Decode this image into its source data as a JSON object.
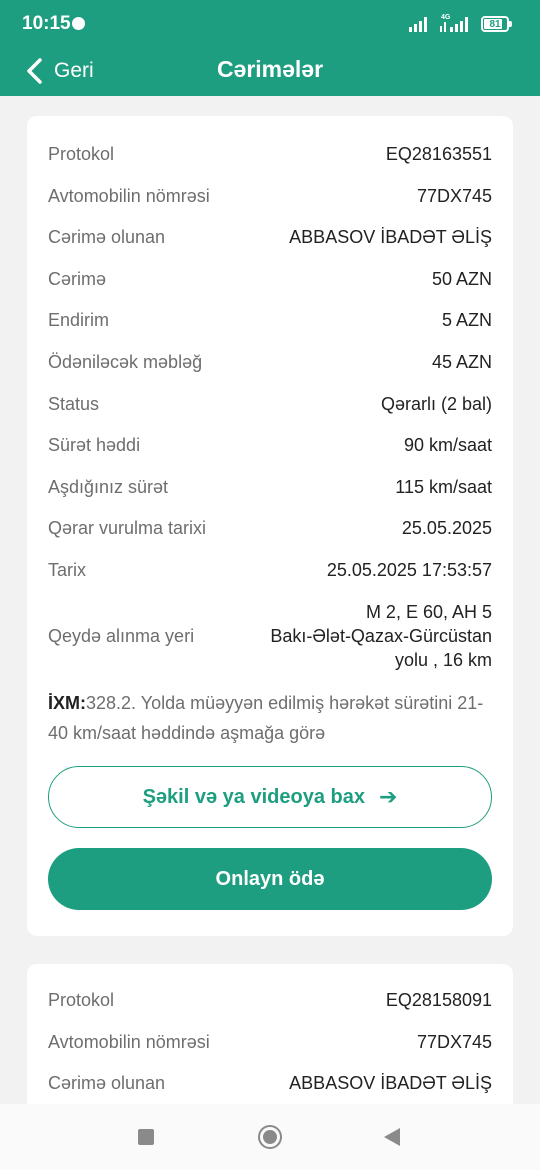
{
  "status_bar": {
    "time": "10:15",
    "network": "4G",
    "battery": "81"
  },
  "app_bar": {
    "back_label": "Geri",
    "title": "Cərimələr"
  },
  "fines": [
    {
      "rows": [
        {
          "label": "Protokol",
          "value": "EQ28163551"
        },
        {
          "label": "Avtomobilin nömrəsi",
          "value": "77DX745"
        },
        {
          "label": "Cərimə olunan",
          "value": "ABBASOV İBADƏT ƏLİŞ"
        },
        {
          "label": "Cərimə",
          "value": "50 AZN"
        },
        {
          "label": "Endirim",
          "value": "5 AZN"
        },
        {
          "label": "Ödəniləcək məbləğ",
          "value": "45 AZN"
        },
        {
          "label": "Status",
          "value": "Qərarlı (2 bal)"
        },
        {
          "label": "Sürət həddi",
          "value": "90 km/saat"
        },
        {
          "label": "Aşdığınız sürət",
          "value": "115 km/saat"
        },
        {
          "label": "Qərar vurulma tarixi",
          "value": "25.05.2025"
        },
        {
          "label": "Tarix",
          "value": "25.05.2025 17:53:57"
        }
      ],
      "location": {
        "label": "Qeydə alınma yeri",
        "lines": [
          "M 2, E 60, AH 5",
          "Bakı-Ələt-Qazax-Gürcüstan",
          "yolu , 16 km"
        ]
      },
      "ixm": {
        "prefix": "İXM:",
        "text": "328.2. Yolda müəyyən edilmiş hərəkət sürətini 21-40 km/saat həddində aşmağa görə"
      },
      "media_button": "Şəkil və ya videoya bax",
      "pay_button": "Onlayn ödə"
    },
    {
      "rows": [
        {
          "label": "Protokol",
          "value": "EQ28158091"
        },
        {
          "label": "Avtomobilin nömrəsi",
          "value": "77DX745"
        },
        {
          "label": "Cərimə olunan",
          "value": "ABBASOV İBADƏT ƏLİŞ"
        }
      ]
    }
  ],
  "icons": {
    "back": "chevron-left-icon",
    "media_arrow": "arrow-right-icon",
    "nav_recents": "square-icon",
    "nav_home": "circle-icon",
    "nav_back": "triangle-back-icon"
  },
  "colors": {
    "primary": "#1e9e80",
    "background": "#f2f2f2",
    "label": "#6e6e6e",
    "value": "#222222"
  }
}
